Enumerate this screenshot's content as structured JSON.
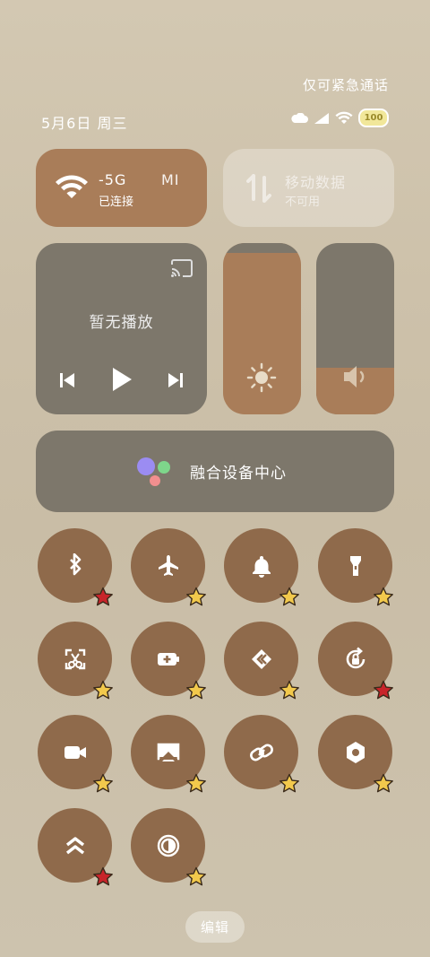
{
  "status": {
    "emergency_text": "仅可紧急通话",
    "date": "5月6日 周三",
    "battery": "100"
  },
  "wifi_tile": {
    "title": "-5G",
    "title_extra": "MI",
    "subtitle": "已连接",
    "active": true
  },
  "mobile_tile": {
    "title": "移动数据",
    "subtitle": "不可用",
    "active": false
  },
  "media": {
    "status_text": "暂无播放"
  },
  "brightness": {
    "level": 0.94
  },
  "volume": {
    "level": 0.27
  },
  "hub": {
    "label": "融合设备中心"
  },
  "toggles": [
    {
      "name": "bluetooth",
      "star": "red"
    },
    {
      "name": "airplane",
      "star": "yellow"
    },
    {
      "name": "bell",
      "star": "yellow"
    },
    {
      "name": "flashlight",
      "star": "yellow"
    },
    {
      "name": "screenshot",
      "star": "yellow"
    },
    {
      "name": "battery-saver",
      "star": "yellow"
    },
    {
      "name": "mirror",
      "star": "yellow"
    },
    {
      "name": "rotation-lock",
      "star": "red"
    },
    {
      "name": "video",
      "star": "yellow"
    },
    {
      "name": "cast",
      "star": "yellow"
    },
    {
      "name": "link",
      "star": "yellow"
    },
    {
      "name": "settings",
      "star": "yellow"
    },
    {
      "name": "boost",
      "star": "red"
    },
    {
      "name": "color-invert",
      "star": "yellow"
    }
  ],
  "edit_label": "编辑",
  "colors": {
    "active": "#a97d59",
    "inactive": "#7d776b",
    "star_red": "#c8242a",
    "star_yellow": "#f2c94c"
  }
}
